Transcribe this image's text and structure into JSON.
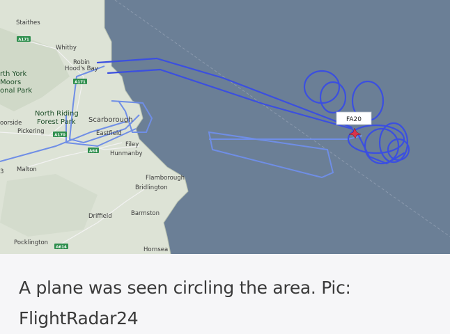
{
  "map": {
    "places": {
      "staithes": "Staithes",
      "whitby": "Whitby",
      "robin_hoods_bay_1": "Robin",
      "robin_hoods_bay_2": "Hood's Bay",
      "north_york_1": "rth York",
      "north_york_2": "Moors",
      "north_york_3": "onal Park",
      "north_riding_1": "North Riding",
      "north_riding_2": "Forest Park",
      "scarborough": "Scarborough",
      "eastfield": "Eastfield",
      "filey": "Filey",
      "hunmanby": "Hunmanby",
      "pickering": "Pickering",
      "moorside": "oorside",
      "malton": "Malton",
      "flamborough": "Flamborough",
      "bridlington": "Bridlington",
      "barmston": "Barmston",
      "driffield": "Driffield",
      "pocklington": "Pocklington",
      "hornsea": "Hornsea",
      "edge_digit": "3"
    },
    "roads": {
      "a171_west": "A171",
      "a171_east": "A171",
      "a170": "A170",
      "a64": "A64",
      "a614": "A614"
    },
    "aircraft_label": "FA20",
    "colors": {
      "sea": "#6b7f96",
      "land": "#dde3d6",
      "track": "#3b4fe0",
      "road_badge": "#2f8f4e"
    }
  },
  "caption": {
    "text": "A plane was seen circling the area. Pic: FlightRadar24"
  }
}
